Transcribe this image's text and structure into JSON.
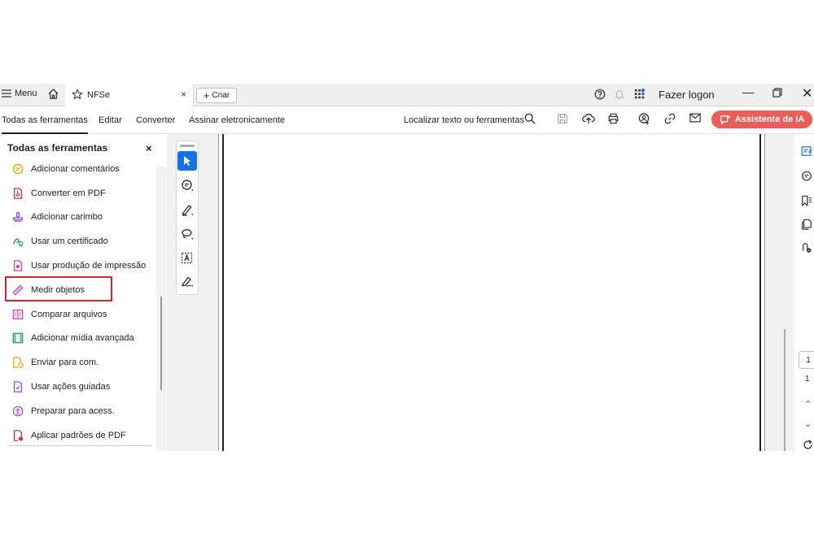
{
  "titlebar": {
    "menu_label": "Menu",
    "tab_label": "NFSe",
    "tab_close": "×",
    "create_label": "Criar",
    "login_label": "Fazer logon",
    "minimize": "—",
    "close": "✕"
  },
  "toolbar": {
    "nav": [
      "Todas as ferramentas",
      "Editar",
      "Converter",
      "Assinar eletronicamente"
    ],
    "search_label": "Localizar texto ou ferramentas",
    "ai_label": "Assistente de IA"
  },
  "panel": {
    "title": "Todas as ferramentas",
    "close": "×",
    "tools": [
      {
        "label": "Adicionar comentários",
        "icon": "comment-icon",
        "color": "#f0a500"
      },
      {
        "label": "Converter em PDF",
        "icon": "pdf-convert-icon",
        "color": "#e0312f"
      },
      {
        "label": "Adicionar carimbo",
        "icon": "stamp-icon",
        "color": "#9b4cd9"
      },
      {
        "label": "Usar um certificado",
        "icon": "certificate-icon",
        "color": "#1a9c8e"
      },
      {
        "label": "Usar produção de impressão",
        "icon": "print-production-icon",
        "color": "#d93fc6"
      },
      {
        "label": "Medir objetos",
        "icon": "ruler-icon",
        "color": "#c048d6"
      },
      {
        "label": "Comparar arquivos",
        "icon": "compare-icon",
        "color": "#d93fc6"
      },
      {
        "label": "Adicionar mídia avançada",
        "icon": "media-icon",
        "color": "#1a9c8e"
      },
      {
        "label": "Enviar para com.",
        "icon": "send-icon",
        "color": "#f0a500"
      },
      {
        "label": "Usar ações guiadas",
        "icon": "guided-actions-icon",
        "color": "#9b4cd9"
      },
      {
        "label": "Preparar para acess.",
        "icon": "accessibility-icon",
        "color": "#9b4cd9"
      },
      {
        "label": "Aplicar padrões de PDF",
        "icon": "pdf-standards-icon",
        "color": "#e0312f"
      }
    ]
  },
  "pager": {
    "current": "1",
    "total": "1"
  },
  "colors": {
    "accent": "#1473e6",
    "ai_button": "#eb5d59",
    "highlight": "#d6262c"
  }
}
